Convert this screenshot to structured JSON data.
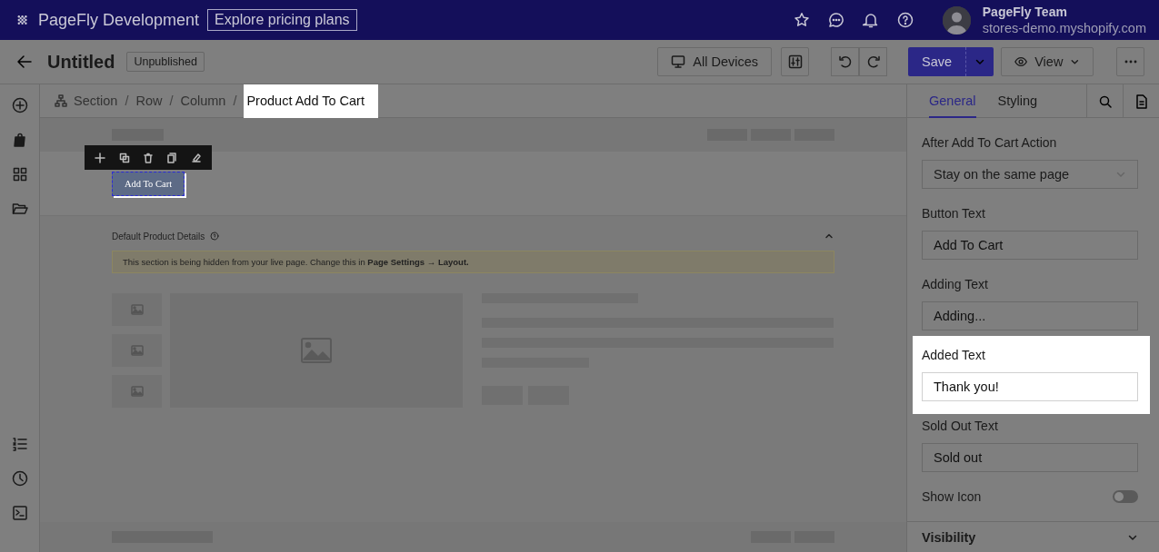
{
  "topbar": {
    "brand": "PageFly Development",
    "pricing_link": "Explore pricing plans",
    "user": {
      "name": "PageFly Team",
      "store": "stores-demo.myshopify.com"
    }
  },
  "toolbar": {
    "title": "Untitled",
    "status": "Unpublished",
    "device": "All Devices",
    "save": "Save",
    "view": "View"
  },
  "breadcrumb": [
    {
      "label": "Section",
      "selected": false
    },
    {
      "separator": "/",
      "label": "Row",
      "selected": false
    },
    {
      "separator": "/",
      "label": "Column",
      "selected": false
    },
    {
      "separator": "/",
      "label": "Product Add To Cart",
      "selected": true
    }
  ],
  "canvas": {
    "button_label": "Add To Cart",
    "section_title": "Default Product Details",
    "notice": "This section is being hidden from your live page. Change this in **Page Settings → Layout.**"
  },
  "panel": {
    "tabs": [
      {
        "label": "General",
        "selected": true
      },
      {
        "label": "Styling",
        "selected": false
      }
    ],
    "fields": [
      {
        "kind": "select",
        "label": "After Add To Cart Action",
        "value": "Stay on the same page",
        "highlighted": false
      },
      {
        "kind": "input",
        "label": "Button Text",
        "value": "Add To Cart",
        "highlighted": false
      },
      {
        "kind": "input",
        "label": "Adding Text",
        "value": "Adding...",
        "highlighted": false
      },
      {
        "kind": "input",
        "label": "Added Text",
        "value": "Thank you!",
        "highlighted": true
      },
      {
        "kind": "input",
        "label": "Sold Out Text",
        "value": "Sold out",
        "highlighted": false
      }
    ],
    "toggle": {
      "label": "Show Icon",
      "on": false
    },
    "section": "Visibility"
  }
}
